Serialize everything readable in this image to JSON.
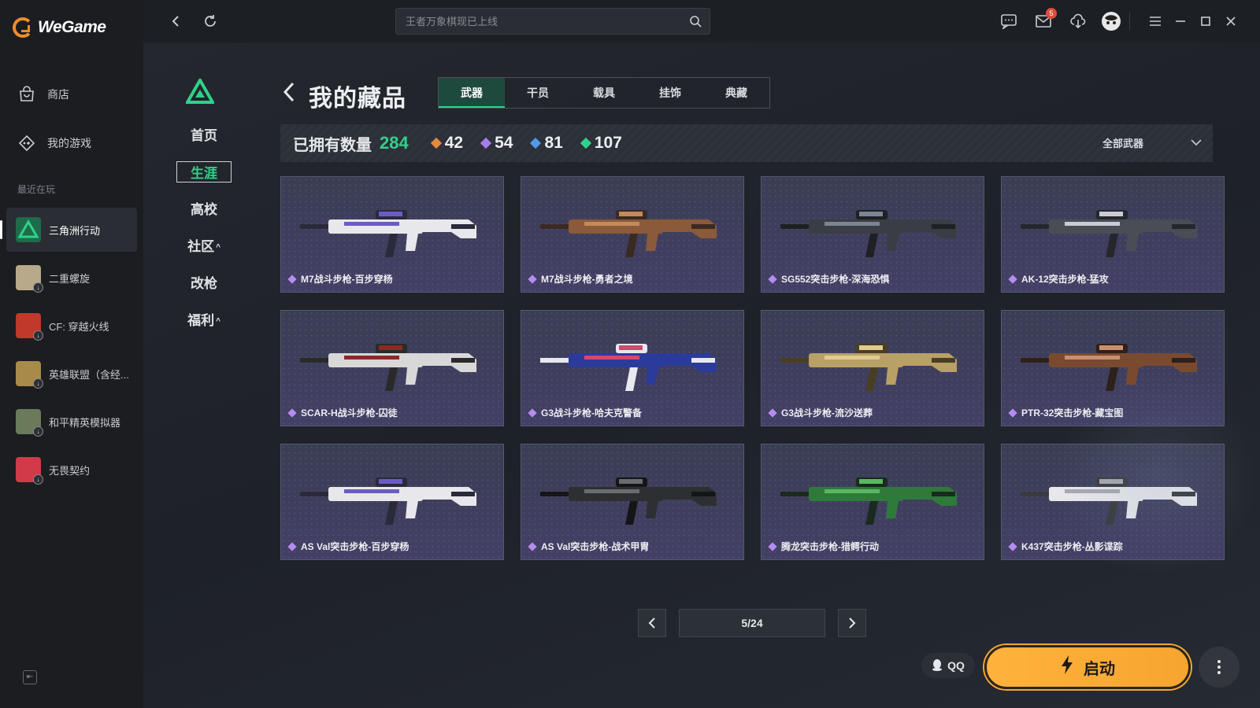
{
  "app": {
    "name": "WeGame"
  },
  "sidebar": {
    "nav": [
      {
        "label": "商店",
        "icon": "store-icon"
      },
      {
        "label": "我的游戏",
        "icon": "games-icon"
      }
    ],
    "recent_title": "最近在玩",
    "games": [
      {
        "label": "三角洲行动",
        "active": true,
        "color": "#1f6b4a"
      },
      {
        "label": "二重螺旋",
        "active": false,
        "color": "#b8a98a"
      },
      {
        "label": "CF: 穿越火线",
        "active": false,
        "color": "#c0392b"
      },
      {
        "label": "英雄联盟（含经...",
        "active": false,
        "color": "#a88b4a"
      },
      {
        "label": "和平精英模拟器",
        "active": false,
        "color": "#6a7a5a"
      },
      {
        "label": "无畏契约",
        "active": false,
        "color": "#d23a4a"
      }
    ]
  },
  "topbar": {
    "search_placeholder": "王者万象棋现已上线",
    "mail_badge": "5"
  },
  "subnav": [
    {
      "label": "首页",
      "active": false,
      "caret": ""
    },
    {
      "label": "生涯",
      "active": true,
      "caret": ""
    },
    {
      "label": "高校",
      "active": false,
      "caret": ""
    },
    {
      "label": "社区",
      "active": false,
      "caret": "^"
    },
    {
      "label": "改枪",
      "active": false,
      "caret": ""
    },
    {
      "label": "福利",
      "active": false,
      "caret": "^"
    }
  ],
  "page": {
    "title": "我的藏品",
    "tabs": [
      {
        "label": "武器",
        "active": true
      },
      {
        "label": "干员",
        "active": false
      },
      {
        "label": "载具",
        "active": false
      },
      {
        "label": "挂饰",
        "active": false
      },
      {
        "label": "典藏",
        "active": false
      }
    ]
  },
  "stats": {
    "owned_label": "已拥有数量",
    "owned_count": "284",
    "tiers": [
      {
        "value": "42",
        "color": "#e78a3c"
      },
      {
        "value": "54",
        "color": "#a77bf0"
      },
      {
        "value": "81",
        "color": "#4f9be6"
      },
      {
        "value": "107",
        "color": "#2fd28b"
      }
    ],
    "filter_label": "全部武器"
  },
  "items": [
    {
      "name": "M7战斗步枪-百步穿杨",
      "palette": [
        "#e8e8ec",
        "#2a2a3a",
        "#6b5cc4"
      ]
    },
    {
      "name": "M7战斗步枪-勇者之境",
      "palette": [
        "#8a5a3a",
        "#3a2a22",
        "#c48a5a"
      ]
    },
    {
      "name": "SG552突击步枪-深海恐惧",
      "palette": [
        "#3a3d44",
        "#1e2024",
        "#7c8594"
      ]
    },
    {
      "name": "AK-12突击步枪-猛攻",
      "palette": [
        "#4a4d55",
        "#25272c",
        "#c8ccd4"
      ]
    },
    {
      "name": "SCAR-H战斗步枪-囚徒",
      "palette": [
        "#d8d8d8",
        "#2a2a2a",
        "#8a2a2a"
      ]
    },
    {
      "name": "G3战斗步枪-哈夫克警备",
      "palette": [
        "#2b3b9a",
        "#e8e8f0",
        "#d04a6a"
      ]
    },
    {
      "name": "G3战斗步枪-流沙送葬",
      "palette": [
        "#b8a066",
        "#4a3e22",
        "#e0cc90"
      ]
    },
    {
      "name": "PTR-32突击步枪-藏宝图",
      "palette": [
        "#7a4a30",
        "#2e201a",
        "#c89070"
      ]
    },
    {
      "name": "AS Val突击步枪-百步穿杨",
      "palette": [
        "#e8e8ec",
        "#2a2a3a",
        "#6b5cc4"
      ]
    },
    {
      "name": "AS Val突击步枪-战术甲胄",
      "palette": [
        "#2e2f32",
        "#141517",
        "#6a6c70"
      ]
    },
    {
      "name": "腾龙突击步枪-猎鳄行动",
      "palette": [
        "#2f7a3a",
        "#1a2a1e",
        "#58b860"
      ]
    },
    {
      "name": "K437突击步枪-丛影谍踪",
      "palette": [
        "#e8e8ec",
        "#3a3a3e",
        "#a8a8b0"
      ]
    }
  ],
  "pagination": {
    "text": "5/24"
  },
  "footer": {
    "qq_label": "QQ",
    "start_label": "启动"
  }
}
